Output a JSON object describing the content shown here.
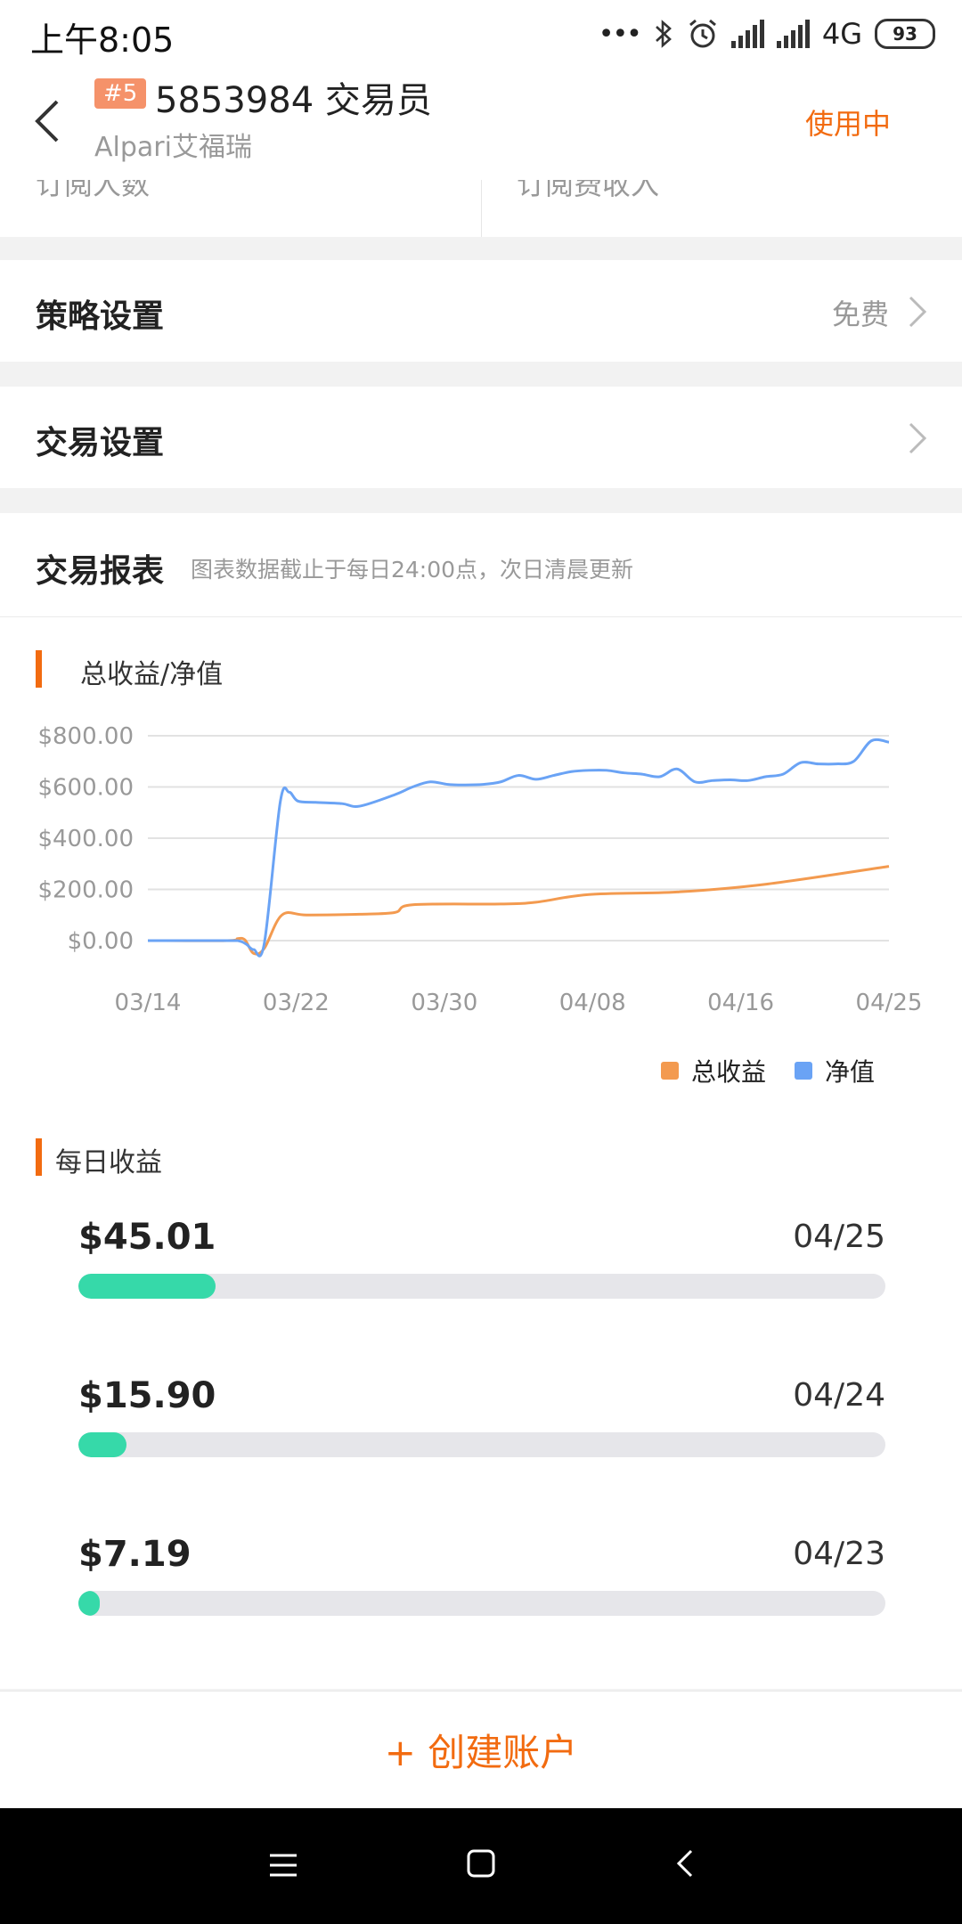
{
  "status_bar": {
    "time": "上午8:05",
    "network": "4G",
    "battery": "93"
  },
  "header": {
    "rank_badge": "#5",
    "title": "5853984 交易员",
    "broker": "Alpari艾福瑞",
    "status": "使用中"
  },
  "stats": {
    "subscribers_label": "订阅人数",
    "subscription_income_label": "订阅费收入"
  },
  "strategy_settings": {
    "label": "策略设置",
    "value": "免费"
  },
  "trade_settings": {
    "label": "交易设置"
  },
  "report": {
    "title": "交易报表",
    "note": "图表数据截止于每日24:00点，次日清晨更新"
  },
  "colors": {
    "accent": "#f26b10",
    "total_profit_line": "#f39a4f",
    "equity_line": "#6aa3f5",
    "bar_fill": "#36d9a9"
  },
  "chart_data": {
    "type": "line",
    "title": "总收益/净值",
    "x_tick_labels": [
      "03/14",
      "03/22",
      "03/30",
      "04/08",
      "04/16",
      "04/25"
    ],
    "y_tick_labels": [
      "$800.00",
      "$600.00",
      "$400.00",
      "$200.00",
      "$0.00"
    ],
    "ylim": [
      0,
      800
    ],
    "xlim_days": [
      0,
      42
    ],
    "grid": true,
    "legend_position": "bottom-right",
    "series": [
      {
        "name": "总收益",
        "color": "#f39a4f",
        "x": [
          0,
          4.5,
          5.1,
          5.5,
          6.0,
          6.6,
          7.6,
          9,
          12,
          14,
          15,
          20,
          22,
          25,
          30,
          35,
          42
        ],
        "y": [
          0,
          0,
          8,
          3,
          -50,
          -30,
          100,
          100,
          103,
          110,
          140,
          143,
          150,
          180,
          190,
          220,
          290
        ]
      },
      {
        "name": "净值",
        "color": "#6aa3f5",
        "x": [
          0,
          4.5,
          5.2,
          5.6,
          6.0,
          6.6,
          7.5,
          8.0,
          8.5,
          9.5,
          11,
          12,
          14,
          15,
          16,
          17,
          18,
          19,
          20,
          21,
          22,
          23,
          24,
          25,
          26,
          27,
          28,
          29,
          30,
          31,
          32,
          33,
          34,
          35,
          36,
          37,
          38,
          39,
          40,
          41,
          42
        ],
        "y": [
          0,
          0,
          -2,
          -15,
          -35,
          -10,
          540,
          580,
          545,
          540,
          535,
          525,
          570,
          600,
          620,
          610,
          608,
          610,
          620,
          645,
          630,
          645,
          660,
          665,
          665,
          655,
          650,
          640,
          670,
          620,
          625,
          628,
          625,
          640,
          650,
          695,
          690,
          690,
          700,
          780,
          775
        ]
      }
    ]
  },
  "daily": {
    "title": "每日收益",
    "items": [
      {
        "amount": "$45.01",
        "date": "04/25",
        "ratio": 0.17
      },
      {
        "amount": "$15.90",
        "date": "04/24",
        "ratio": 0.06
      },
      {
        "amount": "$7.19",
        "date": "04/23",
        "ratio": 0.027
      }
    ]
  },
  "create_account_label": "+ 创建账户"
}
